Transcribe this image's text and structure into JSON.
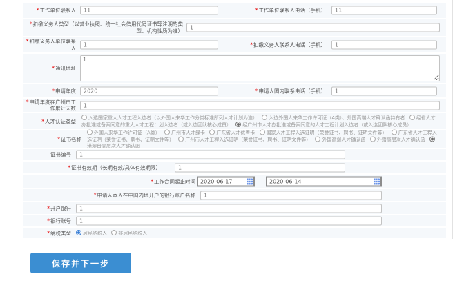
{
  "form": {
    "required_mark": "*",
    "fields": {
      "work_contact": {
        "label": "工作单位联系人",
        "value": "11"
      },
      "work_contact_phone": {
        "label": "工作单位联系人电话（手机）",
        "value": "11"
      },
      "withholder_type": {
        "label": "扣缴义务人类型（以营业执照、统一社会信用代码证书等注明的类型、机构性质为准）",
        "value": "1"
      },
      "withholder_contact": {
        "label": "扣缴义务人单位联系人",
        "value": "1"
      },
      "withholder_phone": {
        "label": "扣缴义务人联系人电话（手机）",
        "value": "1"
      },
      "address": {
        "label": "通讯地址",
        "value": "1"
      },
      "apply_year": {
        "label": "申请年度",
        "value": "2020"
      },
      "applicant_phone": {
        "label": "申请人国内联系电话（手机）",
        "value": "1"
      },
      "work_days": {
        "label": "申请年度在广州市工作累计天数",
        "value": "1"
      },
      "talent_type": {
        "label": "人才认证类型",
        "selected": 3,
        "options": [
          "入选国家重大人才工程入选者（以外国人来华工作分类标准所列人才计划为准）",
          "入选外国人来华工作许可证（A类）、外国高端人才确认函持有者",
          "经省人才办批准或备案同意的重大人才工程计划入选者（或入选团队核心成员）",
          "经广州市人才办批准或备案同意的人才工程计划入选者（或入选团队核心成员）"
        ]
      },
      "cert_name": {
        "label": "证书名称",
        "selected": 8,
        "options": [
          "外国人来华工作许可证（A类）",
          "广州市人才绿卡",
          "广东省人才优粤卡",
          "国家人才工程入选证明（荣誉证书、聘书、证明文件等）",
          "广东省人才工程入选证明（荣誉证书、聘书、证明文件等）",
          "广州市人才工程入选证明（荣誉证书、聘书、证明文件等）",
          "外国高端人才确认函",
          "外籍高层次人才确认函",
          "港澳台高层次人才确认函"
        ]
      },
      "cert_no": {
        "label": "证书编号",
        "value": "1"
      },
      "cert_validity": {
        "label": "证书有效期（长期有效/具体有效期限）",
        "value": "1"
      },
      "contract_period": {
        "label": "工作合同起止时间",
        "start": "2020-06-17",
        "end": "2020-06-14"
      },
      "bank_account_name": {
        "label": "申请人本人在中国内地开户的银行账户名称",
        "value": "1"
      },
      "bank_name": {
        "label": "开户银行",
        "value": "1"
      },
      "bank_account_no": {
        "label": "银行账号",
        "value": "1"
      },
      "tax_type": {
        "label": "纳税类型",
        "selected": 0,
        "options": [
          "居民纳税人",
          "非居民纳税人"
        ]
      }
    }
  },
  "actions": {
    "save_next_label": "保存并下一步"
  },
  "icons": {
    "calendar": "calendar-icon"
  },
  "colors": {
    "button_blue": "#3b8ed2",
    "calendar_blue": "#6b94e8",
    "required_red": "#e60000",
    "row_background": "#f5f8fb",
    "radio_checked_blue": "#3a7fd6"
  }
}
